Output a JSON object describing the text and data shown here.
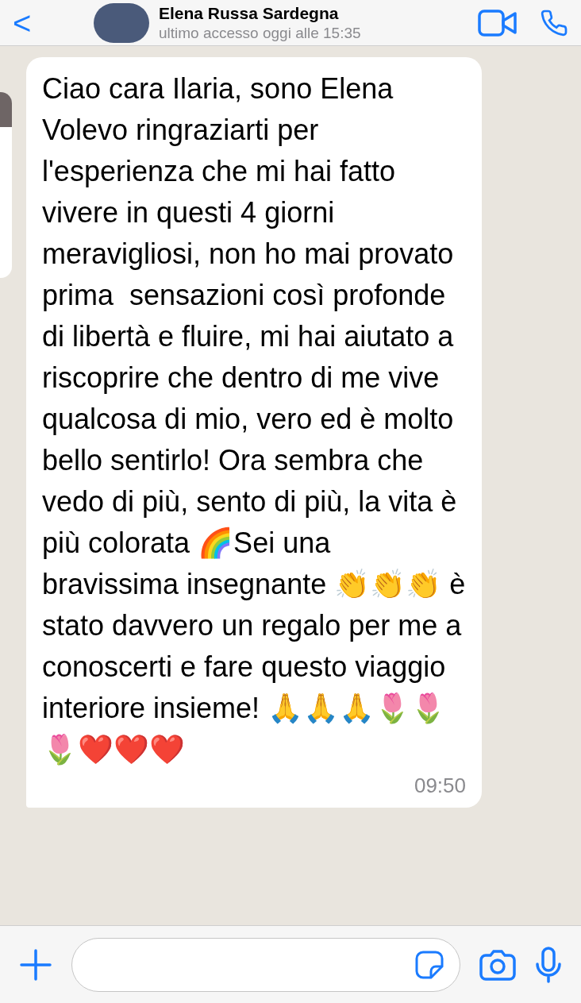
{
  "header": {
    "back_symbol": "<",
    "contact_name": "Elena Russa Sardegna",
    "status": "ultimo accesso oggi alle 15:35"
  },
  "messages": [
    {
      "kind": "incoming",
      "text": "Ciao cara Ilaria, sono Elena\nVolevo ringraziarti per l'esperienza che mi hai fatto vivere in questi 4 giorni meravigliosi, non ho mai provato prima  sensazioni così profonde di libertà e fluire, mi hai aiutato a riscoprire che dentro di me vive qualcosa di mio, vero ed è molto bello sentirlo! Ora sembra che vedo di più, sento di più, la vita è più colorata 🌈Sei una bravissima insegnante 👏👏👏 è stato davvero un regalo per me a conoscerti e fare questo viaggio interiore insieme! 🙏🙏🙏🌷🌷🌷❤️❤️❤️",
      "time": "09:50"
    }
  ]
}
